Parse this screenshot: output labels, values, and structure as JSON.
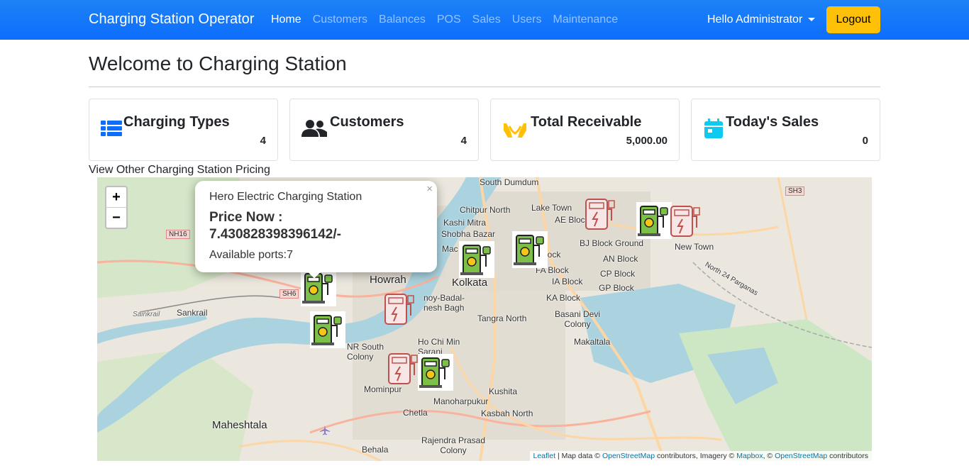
{
  "navbar": {
    "brand": "Charging Station Operator",
    "links": [
      "Home",
      "Customers",
      "Balances",
      "POS",
      "Sales",
      "Users",
      "Maintenance"
    ],
    "user_greeting": "Hello Administrator",
    "logout_label": "Logout",
    "accent": "#0d6efd"
  },
  "page": {
    "title": "Welcome to Charging Station",
    "view_link": "View Other Charging Station Pricing"
  },
  "cards": [
    {
      "label": "Charging Types",
      "value": "4",
      "icon": "list-icon",
      "color": "#0d6efd"
    },
    {
      "label": "Customers",
      "value": "4",
      "icon": "users-icon",
      "color": "#212529"
    },
    {
      "label": "Total Receivable",
      "value": "5,000.00",
      "icon": "hand-holding-icon",
      "color": "#ffc107"
    },
    {
      "label": "Today's Sales",
      "value": "0",
      "icon": "calendar-icon",
      "color": "#0dcaf0"
    }
  ],
  "map": {
    "zoom_in": "+",
    "zoom_out": "−",
    "labels": [
      "South Dumdum",
      "Chitpur North",
      "Lake Town",
      "Kashi Mitra",
      "AE Block",
      "Shobha Bazar",
      "BJ Block Ground",
      "New Town",
      "Howrah",
      "Kolkata",
      "AN Block",
      "CP Block",
      "GP Block",
      "FA Block",
      "IA Block",
      "KA Block",
      "Tangra North",
      "Basani Devi Colony",
      "Makaltala",
      "Sankrail",
      "NR South Colony",
      "Ho Chi Min Sarani",
      "Mominpur",
      "Manoharpukur",
      "Kushita",
      "Chetla",
      "Kasbah North",
      "Maheshtala",
      "Behala",
      "Rajendra Prasad Colony",
      "North 24 Parganas",
      "Sainkrail",
      "noy-Badal-nesh Bagh",
      "Mac",
      "lock"
    ],
    "roads": [
      "NH16",
      "SH6",
      "SH3"
    ],
    "popup": {
      "name": "Hero Electric Charging Station",
      "price": "Price Now : 7.430828398396142/-",
      "ports": "Available ports:7",
      "close": "×"
    },
    "attribution": {
      "leaflet": "Leaflet",
      "text1": " | Map data © ",
      "osm": "OpenStreetMap",
      "text2": " contributors, Imagery © ",
      "mapbox": "Mapbox",
      "text3": ", © ",
      "osm2": "OpenStreetMap",
      "text4": " contributors"
    }
  }
}
